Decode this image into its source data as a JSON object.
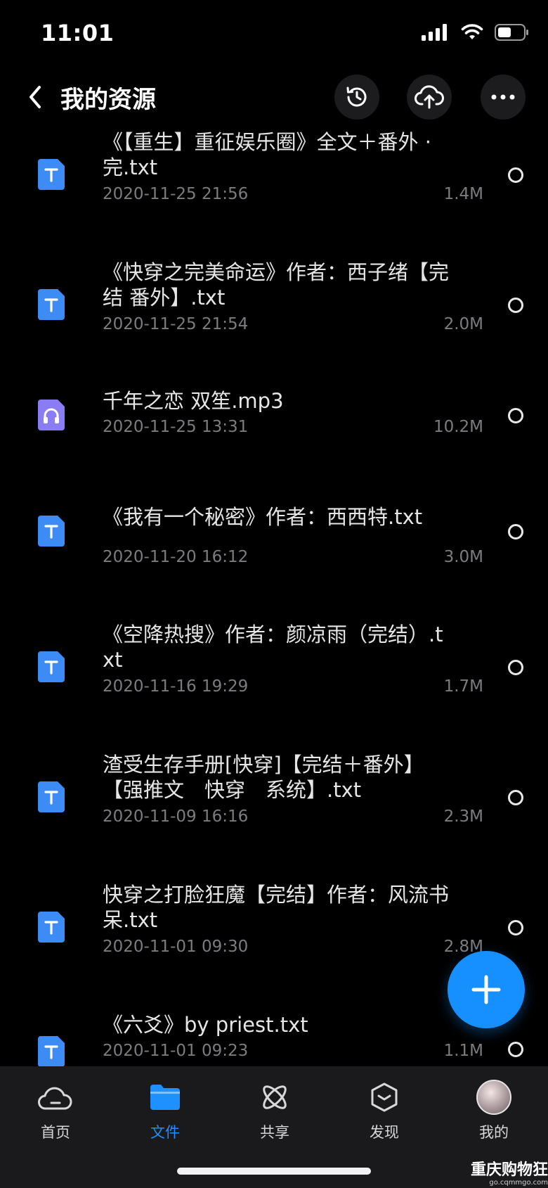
{
  "status_bar": {
    "time": "11:01",
    "icons": [
      "cellular-signal-icon",
      "wifi-icon",
      "battery-icon"
    ]
  },
  "header": {
    "title": "我的资源",
    "back_icon": "chevron-left-icon",
    "actions": [
      "history-icon",
      "cloud-upload-icon",
      "more-icon"
    ]
  },
  "files": [
    {
      "name": "《【重生】重征娱乐圈》全文＋番外 · 完.txt",
      "date": "2020-11-25 21:56",
      "size": "1.4M",
      "type": "txt"
    },
    {
      "name": "《快穿之完美命运》作者：西子绪【完结 番外】.txt",
      "date": "2020-11-25 21:54",
      "size": "2.0M",
      "type": "txt"
    },
    {
      "name": "千年之恋 双笙.mp3",
      "date": "2020-11-25 13:31",
      "size": "10.2M",
      "type": "audio"
    },
    {
      "name": "《我有一个秘密》作者：西西特.txt",
      "date": "2020-11-20 16:12",
      "size": "3.0M",
      "type": "txt"
    },
    {
      "name": "《空降热搜》作者：颜凉雨（完结）.txt",
      "date": "2020-11-16 19:29",
      "size": "1.7M",
      "type": "txt"
    },
    {
      "name": "渣受生存手册[快穿]【完结＋番外】【强推文　快穿　系统】.txt",
      "date": "2020-11-09 16:16",
      "size": "2.3M",
      "type": "txt"
    },
    {
      "name": "快穿之打脸狂魔【完结】作者：风流书呆.txt",
      "date": "2020-11-01 09:30",
      "size": "2.8M",
      "type": "txt"
    },
    {
      "name": "《六爻》by priest.txt",
      "date": "2020-11-01 09:23",
      "size": "1.1M",
      "type": "txt"
    }
  ],
  "fab": {
    "icon": "plus-icon"
  },
  "nav": {
    "items": [
      {
        "label": "首页",
        "icon": "cloud-home-icon",
        "active": false
      },
      {
        "label": "文件",
        "icon": "folder-icon",
        "active": true
      },
      {
        "label": "共享",
        "icon": "atom-share-icon",
        "active": false
      },
      {
        "label": "发现",
        "icon": "discover-box-icon",
        "active": false
      },
      {
        "label": "我的",
        "icon": "avatar",
        "active": false
      }
    ]
  },
  "watermark": {
    "line1": "重庆购物狂",
    "line2": "go.cqmmgo.com"
  },
  "colors": {
    "background": "#000000",
    "accent": "#1690ff",
    "txt_icon": "#3d8cf5",
    "audio_icon": "#8a7cf3",
    "secondary_text": "#7c7c80",
    "nav_background": "#1a1a1c"
  }
}
